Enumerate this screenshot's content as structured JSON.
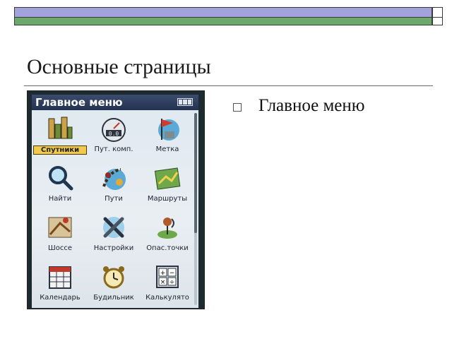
{
  "slide": {
    "title": "Основные страницы",
    "bullets": [
      "Главное меню"
    ]
  },
  "device": {
    "screen_title": "Главное меню",
    "menu": [
      {
        "label": "Спутники",
        "icon": "satellite-icon",
        "selected": true
      },
      {
        "label": "Пут. комп.",
        "icon": "trip-computer-icon",
        "selected": false
      },
      {
        "label": "Метка",
        "icon": "mark-flag-icon",
        "selected": false
      },
      {
        "label": "Найти",
        "icon": "magnifier-icon",
        "selected": false
      },
      {
        "label": "Пути",
        "icon": "tracks-icon",
        "selected": false
      },
      {
        "label": "Маршруты",
        "icon": "routes-map-icon",
        "selected": false
      },
      {
        "label": "Шоссе",
        "icon": "highway-map-icon",
        "selected": false
      },
      {
        "label": "Настройки",
        "icon": "wrench-icon",
        "selected": false
      },
      {
        "label": "Опас.точки",
        "icon": "danger-point-icon",
        "selected": false
      },
      {
        "label": "Календарь",
        "icon": "calendar-icon",
        "selected": false
      },
      {
        "label": "Будильник",
        "icon": "alarm-clock-icon",
        "selected": false
      },
      {
        "label": "Калькулято",
        "icon": "calculator-icon",
        "selected": false
      }
    ]
  },
  "colors": {
    "bar_top": "#a3a3dc",
    "bar_bottom": "#6ca86c",
    "selected_label": "#f3c94a",
    "screen_header": "#2f3d5c"
  }
}
